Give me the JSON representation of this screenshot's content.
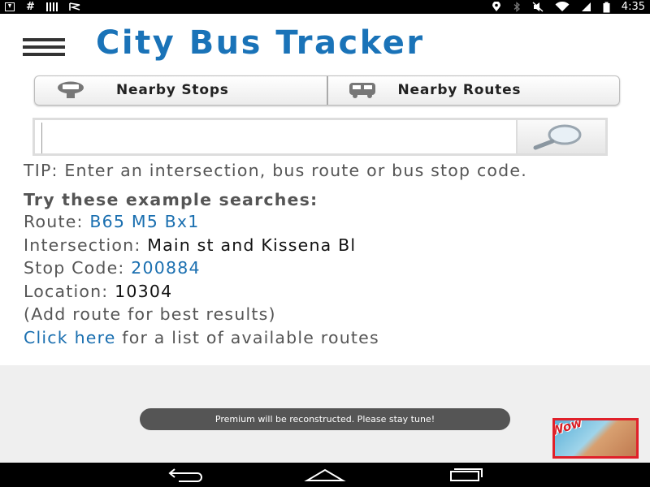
{
  "status_bar": {
    "time": "4:35",
    "left_icons": [
      "download-icon",
      "hash-icon",
      "barcode-icon",
      "flag-icon"
    ],
    "right_icons": [
      "location-icon",
      "bluetooth-icon",
      "mute-icon",
      "wifi-icon",
      "signal-icon",
      "battery-icon"
    ]
  },
  "header": {
    "title": "City Bus Tracker",
    "menu_icon": "hamburger-menu-icon"
  },
  "tabs": [
    {
      "label": "Nearby Stops",
      "icon": "bus-stop-icon"
    },
    {
      "label": "Nearby Routes",
      "icon": "bus-icon"
    }
  ],
  "search": {
    "value": "",
    "placeholder": "",
    "button_icon": "magnifier-icon"
  },
  "tip": "TIP: Enter an intersection, bus route or bus stop code.",
  "examples": {
    "heading": "Try these example searches:",
    "route_label": "Route:",
    "routes": [
      "B65",
      "M5",
      "Bx1"
    ],
    "intersection_label": "Intersection:",
    "intersection_value": "Main st and Kissena Bl",
    "stop_code_label": "Stop Code:",
    "stop_code_value": "200884",
    "location_label": "Location:",
    "location_value": "10304",
    "note": "(Add route for best results)",
    "click_here": "Click here",
    "click_here_suffix": "for a list of available routes"
  },
  "toast": "Premium will be reconstructed. Please stay tune!",
  "ad": {
    "text": "Wow"
  },
  "nav_bar": {
    "buttons": [
      "back-icon",
      "home-icon",
      "recents-icon"
    ]
  },
  "colors": {
    "title": "#1a73b8",
    "link": "#1a6fb0",
    "text": "#555555",
    "ad_border": "#e0202a"
  }
}
